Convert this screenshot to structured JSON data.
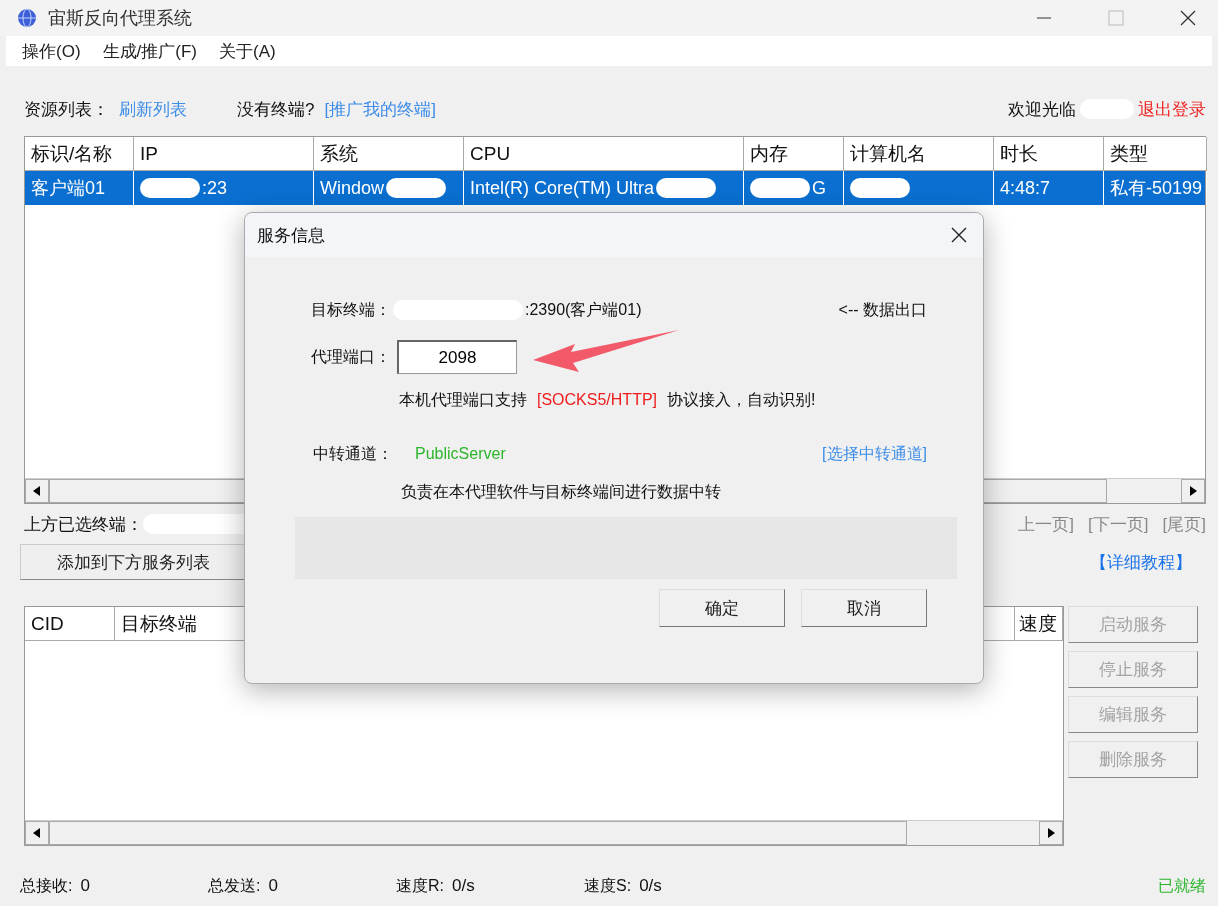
{
  "window": {
    "title": "宙斯反向代理系统"
  },
  "menu": [
    {
      "label": "操作(O)"
    },
    {
      "label": "生成/推广(F)"
    },
    {
      "label": "关于(A)"
    }
  ],
  "toolbar": {
    "resource_label": "资源列表：",
    "refresh_link": "刷新列表",
    "no_terminal": "没有终端?",
    "promote_link": "[推广我的终端]",
    "welcome": "欢迎光临",
    "logout": "退出登录"
  },
  "resource_table": {
    "columns": [
      "标识/名称",
      "IP",
      "系统",
      "CPU",
      "内存",
      "计算机名",
      "时长",
      "类型"
    ],
    "rows": [
      {
        "selected": true,
        "cells": [
          {
            "text": "客户端01"
          },
          {
            "text": ":23",
            "redacted_before": true
          },
          {
            "text": "Window",
            "redacted_after": true
          },
          {
            "text": "Intel(R) Core(TM) Ultra",
            "redacted_after": true
          },
          {
            "text": "G",
            "redacted_before": true
          },
          {
            "redacted_before": true
          },
          {
            "text": "4:48:7"
          },
          {
            "text": "私有-50199"
          }
        ]
      }
    ]
  },
  "selected_terminal": {
    "label": "上方已选终端："
  },
  "pager": [
    "上一页]",
    "[下一页]",
    "[尾页]"
  ],
  "add_button": "添加到下方服务列表",
  "tutorial_link": "【详细教程】",
  "service_table": {
    "columns": [
      "CID",
      "目标终端",
      "速度"
    ]
  },
  "service_buttons": [
    {
      "label": "启动服务",
      "disabled": true
    },
    {
      "label": "停止服务",
      "disabled": true
    },
    {
      "label": "编辑服务",
      "disabled": true
    },
    {
      "label": "删除服务",
      "disabled": true
    }
  ],
  "status_bar": [
    {
      "label": "总接收:",
      "value": "0"
    },
    {
      "label": "总发送:",
      "value": "0"
    },
    {
      "label": "速度R:",
      "value": "0/s"
    },
    {
      "label": "速度S:",
      "value": "0/s"
    }
  ],
  "status": "已就绪",
  "dialog": {
    "title": "服务信息",
    "target_label": "目标终端：",
    "target_value": ":2390(客户端01)",
    "data_exit": "<-- 数据出口",
    "port_label": "代理端口：",
    "port_value": "2098",
    "support_note_before": "本机代理端口支持",
    "support_protocols": "[SOCKS5/HTTP]",
    "support_note_after": "协议接入，自动识别!",
    "relay_label": "中转通道：",
    "relay_value": "PublicServer",
    "relay_link": "[选择中转通道]",
    "relay_note": "负责在本代理软件与目标终端间进行数据中转",
    "ok": "确定",
    "cancel": "取消"
  }
}
